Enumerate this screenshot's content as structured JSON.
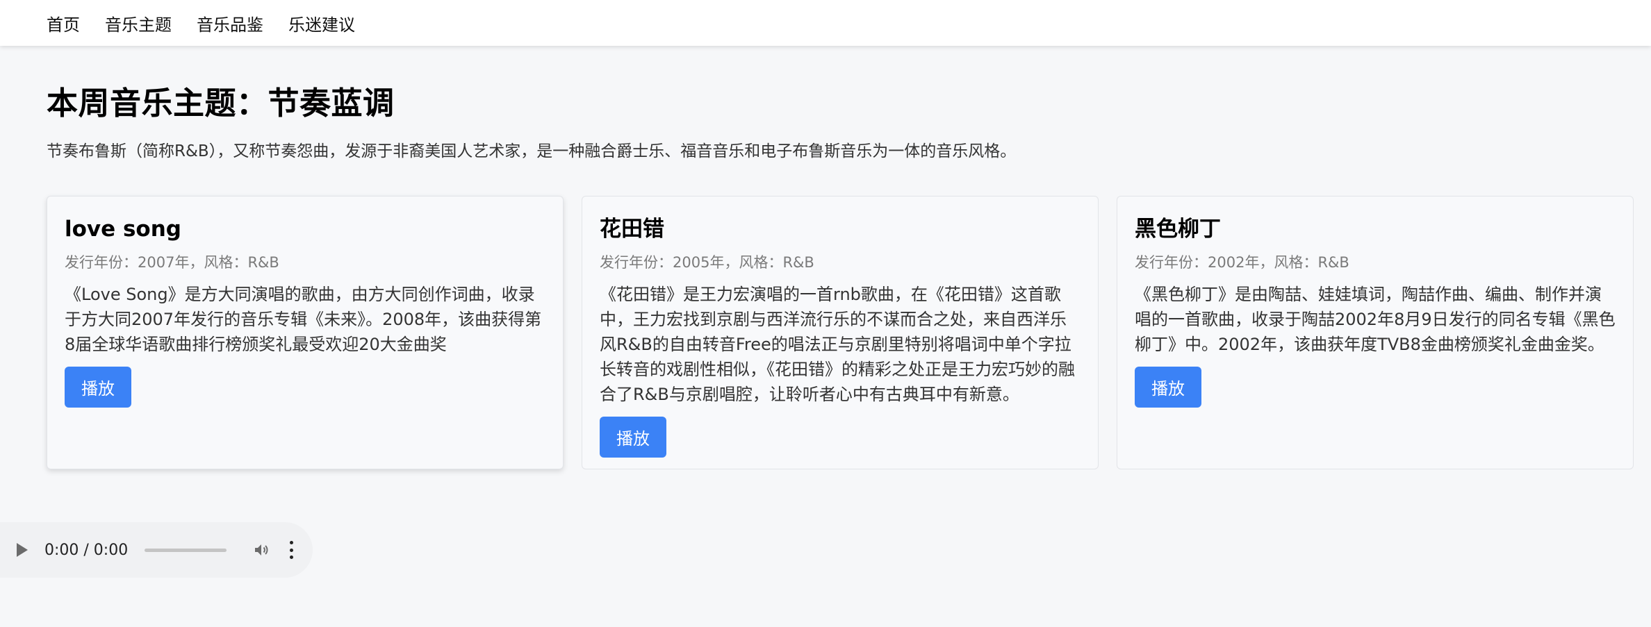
{
  "nav": {
    "items": [
      {
        "label": "首页"
      },
      {
        "label": "音乐主题"
      },
      {
        "label": "音乐品鉴"
      },
      {
        "label": "乐迷建议"
      }
    ]
  },
  "header": {
    "title": "本周音乐主题：节奏蓝调",
    "description": "节奏布鲁斯（简称R&B），又称节奏怨曲，发源于非裔美国人艺术家，是一种融合爵士乐、福音音乐和电子布鲁斯音乐为一体的音乐风格。"
  },
  "songs": [
    {
      "title": "love song",
      "meta": "发行年份：2007年，风格：R&B",
      "description": "《Love Song》是方大同演唱的歌曲，由方大同创作词曲，收录于方大同2007年发行的音乐专辑《未来》。2008年，该曲获得第8届全球华语歌曲排行榜颁奖礼最受欢迎20大金曲奖",
      "button_label": "播放"
    },
    {
      "title": "花田错",
      "meta": "发行年份：2005年，风格：R&B",
      "description": "《花田错》是王力宏演唱的一首rnb歌曲，在《花田错》这首歌中，王力宏找到京剧与西洋流行乐的不谋而合之处，来自西洋乐风R&B的自由转音Free的唱法正与京剧里特别将唱词中单个字拉长转音的戏剧性相似，《花田错》的精彩之处正是王力宏巧妙的融合了R&B与京剧唱腔，让聆听者心中有古典耳中有新意。",
      "button_label": "播放"
    },
    {
      "title": "黑色柳丁",
      "meta": "发行年份：2002年，风格：R&B",
      "description": "《黑色柳丁》是由陶喆、娃娃填词，陶喆作曲、编曲、制作并演唱的一首歌曲，收录于陶喆2002年8月9日发行的同名专辑《黑色柳丁》中。2002年，该曲获年度TVB8金曲榜颁奖礼金曲金奖。",
      "button_label": "播放"
    }
  ],
  "player": {
    "time": "0:00 / 0:00",
    "progress": 0
  },
  "colors": {
    "accent": "#3b82f6",
    "background": "#f6f7f9",
    "card_background": "#f8f9fb"
  },
  "icons": {
    "play": "play-icon",
    "volume": "volume-icon",
    "more": "more-options-icon"
  }
}
